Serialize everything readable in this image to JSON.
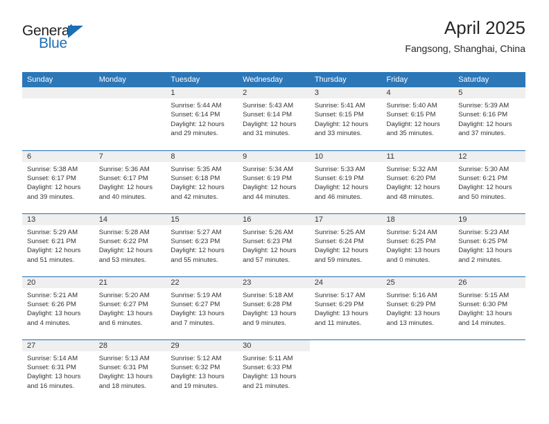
{
  "logo": {
    "word1": "General",
    "word2": "Blue",
    "triangle_color": "#1c6fb5",
    "icon": "triangle-icon"
  },
  "header": {
    "title": "April 2025",
    "subtitle": "Fangsong, Shanghai, China"
  },
  "colors": {
    "header_blue": "#2c77b8",
    "row_rule_blue": "#1f6eb4",
    "daynum_band": "#efefef",
    "text": "#333333"
  },
  "calendar": {
    "weekday_headers": [
      "Sunday",
      "Monday",
      "Tuesday",
      "Wednesday",
      "Thursday",
      "Friday",
      "Saturday"
    ],
    "labels": {
      "sunrise": "Sunrise:",
      "sunset": "Sunset:",
      "daylight": "Daylight:"
    },
    "weeks": [
      [
        {
          "day": "",
          "empty": true
        },
        {
          "day": "",
          "empty": true
        },
        {
          "day": "1",
          "sunrise": "Sunrise: 5:44 AM",
          "sunset": "Sunset: 6:14 PM",
          "daylight1": "Daylight: 12 hours",
          "daylight2": "and 29 minutes."
        },
        {
          "day": "2",
          "sunrise": "Sunrise: 5:43 AM",
          "sunset": "Sunset: 6:14 PM",
          "daylight1": "Daylight: 12 hours",
          "daylight2": "and 31 minutes."
        },
        {
          "day": "3",
          "sunrise": "Sunrise: 5:41 AM",
          "sunset": "Sunset: 6:15 PM",
          "daylight1": "Daylight: 12 hours",
          "daylight2": "and 33 minutes."
        },
        {
          "day": "4",
          "sunrise": "Sunrise: 5:40 AM",
          "sunset": "Sunset: 6:15 PM",
          "daylight1": "Daylight: 12 hours",
          "daylight2": "and 35 minutes."
        },
        {
          "day": "5",
          "sunrise": "Sunrise: 5:39 AM",
          "sunset": "Sunset: 6:16 PM",
          "daylight1": "Daylight: 12 hours",
          "daylight2": "and 37 minutes."
        }
      ],
      [
        {
          "day": "6",
          "sunrise": "Sunrise: 5:38 AM",
          "sunset": "Sunset: 6:17 PM",
          "daylight1": "Daylight: 12 hours",
          "daylight2": "and 39 minutes."
        },
        {
          "day": "7",
          "sunrise": "Sunrise: 5:36 AM",
          "sunset": "Sunset: 6:17 PM",
          "daylight1": "Daylight: 12 hours",
          "daylight2": "and 40 minutes."
        },
        {
          "day": "8",
          "sunrise": "Sunrise: 5:35 AM",
          "sunset": "Sunset: 6:18 PM",
          "daylight1": "Daylight: 12 hours",
          "daylight2": "and 42 minutes."
        },
        {
          "day": "9",
          "sunrise": "Sunrise: 5:34 AM",
          "sunset": "Sunset: 6:19 PM",
          "daylight1": "Daylight: 12 hours",
          "daylight2": "and 44 minutes."
        },
        {
          "day": "10",
          "sunrise": "Sunrise: 5:33 AM",
          "sunset": "Sunset: 6:19 PM",
          "daylight1": "Daylight: 12 hours",
          "daylight2": "and 46 minutes."
        },
        {
          "day": "11",
          "sunrise": "Sunrise: 5:32 AM",
          "sunset": "Sunset: 6:20 PM",
          "daylight1": "Daylight: 12 hours",
          "daylight2": "and 48 minutes."
        },
        {
          "day": "12",
          "sunrise": "Sunrise: 5:30 AM",
          "sunset": "Sunset: 6:21 PM",
          "daylight1": "Daylight: 12 hours",
          "daylight2": "and 50 minutes."
        }
      ],
      [
        {
          "day": "13",
          "sunrise": "Sunrise: 5:29 AM",
          "sunset": "Sunset: 6:21 PM",
          "daylight1": "Daylight: 12 hours",
          "daylight2": "and 51 minutes."
        },
        {
          "day": "14",
          "sunrise": "Sunrise: 5:28 AM",
          "sunset": "Sunset: 6:22 PM",
          "daylight1": "Daylight: 12 hours",
          "daylight2": "and 53 minutes."
        },
        {
          "day": "15",
          "sunrise": "Sunrise: 5:27 AM",
          "sunset": "Sunset: 6:23 PM",
          "daylight1": "Daylight: 12 hours",
          "daylight2": "and 55 minutes."
        },
        {
          "day": "16",
          "sunrise": "Sunrise: 5:26 AM",
          "sunset": "Sunset: 6:23 PM",
          "daylight1": "Daylight: 12 hours",
          "daylight2": "and 57 minutes."
        },
        {
          "day": "17",
          "sunrise": "Sunrise: 5:25 AM",
          "sunset": "Sunset: 6:24 PM",
          "daylight1": "Daylight: 12 hours",
          "daylight2": "and 59 minutes."
        },
        {
          "day": "18",
          "sunrise": "Sunrise: 5:24 AM",
          "sunset": "Sunset: 6:25 PM",
          "daylight1": "Daylight: 13 hours",
          "daylight2": "and 0 minutes."
        },
        {
          "day": "19",
          "sunrise": "Sunrise: 5:23 AM",
          "sunset": "Sunset: 6:25 PM",
          "daylight1": "Daylight: 13 hours",
          "daylight2": "and 2 minutes."
        }
      ],
      [
        {
          "day": "20",
          "sunrise": "Sunrise: 5:21 AM",
          "sunset": "Sunset: 6:26 PM",
          "daylight1": "Daylight: 13 hours",
          "daylight2": "and 4 minutes."
        },
        {
          "day": "21",
          "sunrise": "Sunrise: 5:20 AM",
          "sunset": "Sunset: 6:27 PM",
          "daylight1": "Daylight: 13 hours",
          "daylight2": "and 6 minutes."
        },
        {
          "day": "22",
          "sunrise": "Sunrise: 5:19 AM",
          "sunset": "Sunset: 6:27 PM",
          "daylight1": "Daylight: 13 hours",
          "daylight2": "and 7 minutes."
        },
        {
          "day": "23",
          "sunrise": "Sunrise: 5:18 AM",
          "sunset": "Sunset: 6:28 PM",
          "daylight1": "Daylight: 13 hours",
          "daylight2": "and 9 minutes."
        },
        {
          "day": "24",
          "sunrise": "Sunrise: 5:17 AM",
          "sunset": "Sunset: 6:29 PM",
          "daylight1": "Daylight: 13 hours",
          "daylight2": "and 11 minutes."
        },
        {
          "day": "25",
          "sunrise": "Sunrise: 5:16 AM",
          "sunset": "Sunset: 6:29 PM",
          "daylight1": "Daylight: 13 hours",
          "daylight2": "and 13 minutes."
        },
        {
          "day": "26",
          "sunrise": "Sunrise: 5:15 AM",
          "sunset": "Sunset: 6:30 PM",
          "daylight1": "Daylight: 13 hours",
          "daylight2": "and 14 minutes."
        }
      ],
      [
        {
          "day": "27",
          "sunrise": "Sunrise: 5:14 AM",
          "sunset": "Sunset: 6:31 PM",
          "daylight1": "Daylight: 13 hours",
          "daylight2": "and 16 minutes."
        },
        {
          "day": "28",
          "sunrise": "Sunrise: 5:13 AM",
          "sunset": "Sunset: 6:31 PM",
          "daylight1": "Daylight: 13 hours",
          "daylight2": "and 18 minutes."
        },
        {
          "day": "29",
          "sunrise": "Sunrise: 5:12 AM",
          "sunset": "Sunset: 6:32 PM",
          "daylight1": "Daylight: 13 hours",
          "daylight2": "and 19 minutes."
        },
        {
          "day": "30",
          "sunrise": "Sunrise: 5:11 AM",
          "sunset": "Sunset: 6:33 PM",
          "daylight1": "Daylight: 13 hours",
          "daylight2": "and 21 minutes."
        },
        {
          "day": "",
          "empty": true,
          "no_band": true
        },
        {
          "day": "",
          "empty": true,
          "no_band": true
        },
        {
          "day": "",
          "empty": true,
          "no_band": true
        }
      ]
    ]
  }
}
